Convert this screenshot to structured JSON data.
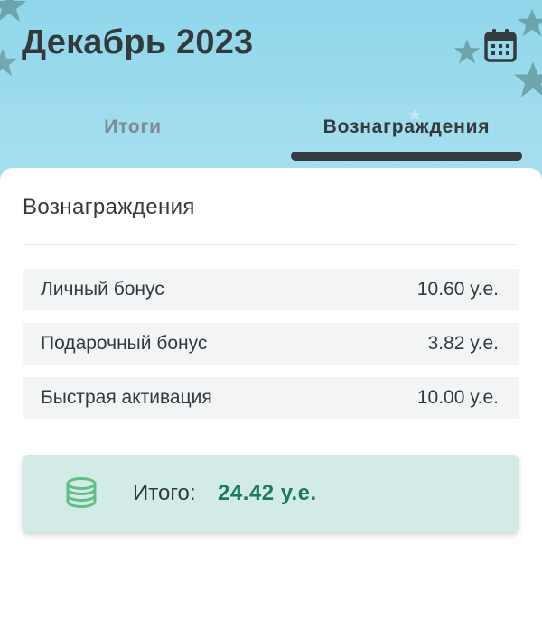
{
  "header": {
    "title": "Декабрь 2023",
    "calendar_icon": "calendar-icon"
  },
  "tabs": [
    {
      "label": "Итоги",
      "active": false
    },
    {
      "label": "Вознаграждения",
      "active": true
    }
  ],
  "rewards": {
    "title": "Вознаграждения",
    "items": [
      {
        "label": "Личный бонус",
        "value": "10.60 у.е."
      },
      {
        "label": "Подарочный бонус",
        "value": "3.82 у.е."
      },
      {
        "label": "Быстрая активация",
        "value": "10.00 у.е."
      }
    ],
    "total": {
      "icon": "coins-icon",
      "label": "Итого:",
      "value": "24.42 у.е."
    }
  },
  "colors": {
    "header_bg": "#9fdcee",
    "text": "#333a3c",
    "tab_inactive": "#7c8c92",
    "accent_green": "#1b7a63",
    "coins_icon": "#5fbf85",
    "total_bg": "#d3ebe6"
  }
}
